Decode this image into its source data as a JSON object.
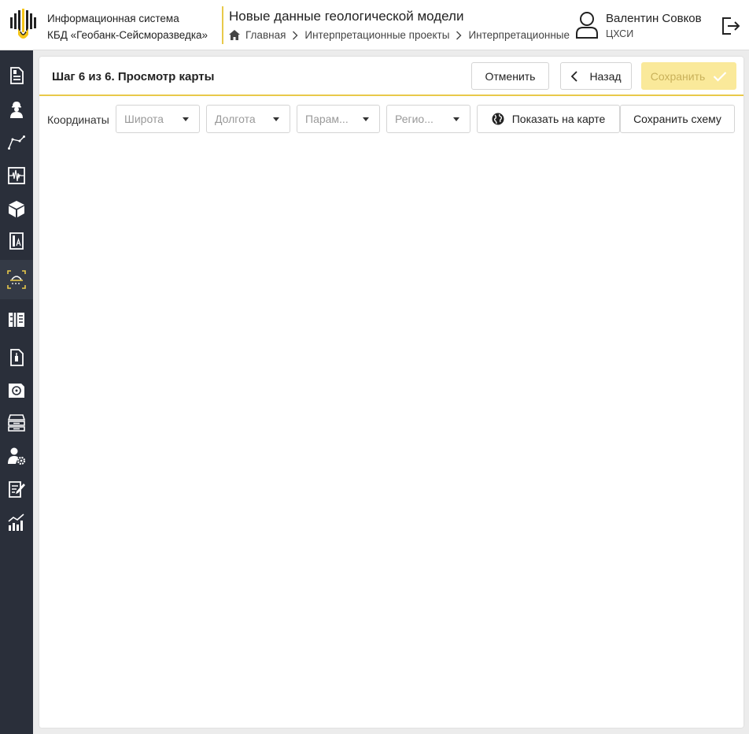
{
  "header": {
    "system_line1": "Информационная система",
    "system_line2": "КБД «Геобанк-Сейсморазведка»",
    "title": "Новые данные геологической модели",
    "breadcrumbs": [
      "Главная",
      "Интерпретационные проекты",
      "Интерпретационные"
    ],
    "user_name": "Валентин Совков",
    "user_org": "ЦХСИ"
  },
  "sidebar": {
    "items": [
      {
        "icon": "document-icon"
      },
      {
        "icon": "worker-icon"
      },
      {
        "icon": "line-path-icon"
      },
      {
        "icon": "seismic-trace-icon"
      },
      {
        "icon": "cube-icon"
      },
      {
        "icon": "map-document-icon"
      },
      {
        "icon": "survey-area-icon",
        "active": true
      },
      {
        "icon": "well-log-icon"
      },
      {
        "icon": "file-icon"
      },
      {
        "icon": "disk-icon"
      },
      {
        "icon": "inbox-icon"
      },
      {
        "icon": "user-settings-icon"
      },
      {
        "icon": "notes-icon"
      },
      {
        "icon": "analytics-chart-icon"
      }
    ]
  },
  "main": {
    "step_title": "Шаг 6 из 6. Просмотр карты",
    "cancel_label": "Отменить",
    "back_label": "Назад",
    "save_label": "Сохранить",
    "coordinates_label": "Координаты",
    "filters": {
      "latitude_placeholder": "Широта",
      "longitude_placeholder": "Долгота",
      "parameter_placeholder": "Парам...",
      "region_placeholder": "Регио..."
    },
    "show_on_map_label": "Показать на карте",
    "save_scheme_label": "Сохранить схему"
  },
  "colors": {
    "accent": "#e8c94a",
    "sidebar_bg": "#2a2f3a",
    "save_disabled_bg": "#fae99a"
  }
}
